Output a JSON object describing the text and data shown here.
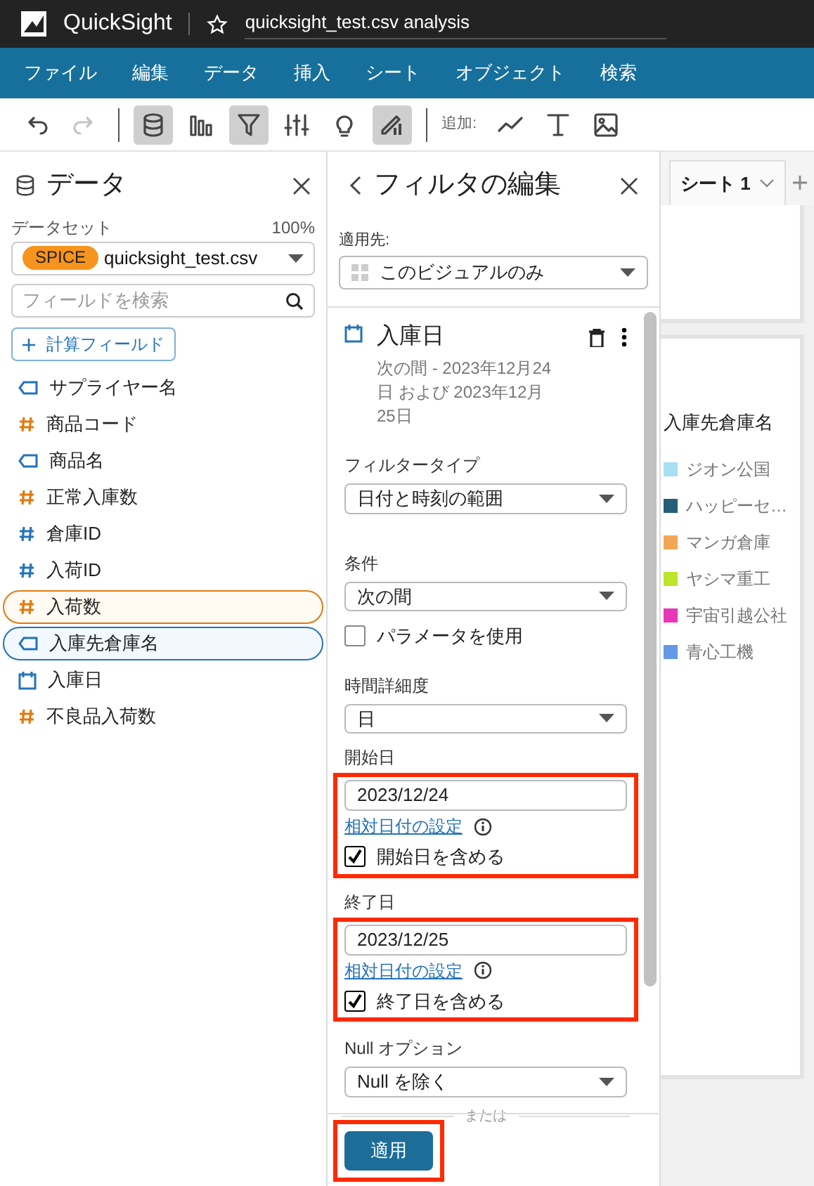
{
  "app": {
    "name": "QuickSight",
    "document_title": "quicksight_test.csv analysis"
  },
  "menu": [
    "ファイル",
    "編集",
    "データ",
    "挿入",
    "シート",
    "オブジェクト",
    "検索"
  ],
  "toolbar": {
    "groups": [
      [
        {
          "kind": "undo",
          "disabled": false,
          "active": false
        },
        {
          "kind": "redo",
          "disabled": true,
          "active": false
        }
      ],
      [
        {
          "kind": "data",
          "disabled": false,
          "active": true
        },
        {
          "kind": "visualize",
          "disabled": false,
          "active": false
        },
        {
          "kind": "filter",
          "disabled": false,
          "active": true
        },
        {
          "kind": "parameters",
          "disabled": false,
          "active": false
        },
        {
          "kind": "insights",
          "disabled": false,
          "active": false
        },
        {
          "kind": "format",
          "disabled": false,
          "active": true
        }
      ]
    ],
    "add_label": "追加:",
    "add_tools": [
      {
        "kind": "line"
      },
      {
        "kind": "text"
      },
      {
        "kind": "image"
      }
    ]
  },
  "data_panel": {
    "title": "データ",
    "dataset_label": "データセット",
    "dataset_percent": "100%",
    "spice_badge": "SPICE",
    "dataset": "quicksight_test.csv",
    "search": {
      "placeholder": "フィールドを検索"
    },
    "add_calc_field": "計算フィールド",
    "fields": [
      {
        "name": "サプライヤー名",
        "kind": "dimension",
        "selected": false
      },
      {
        "name": "商品コード",
        "kind": "measure",
        "selected": false
      },
      {
        "name": "商品名",
        "kind": "dimension",
        "selected": false
      },
      {
        "name": "正常入庫数",
        "kind": "measure",
        "selected": false
      },
      {
        "name": "倉庫ID",
        "kind": "id",
        "selected": false
      },
      {
        "name": "入荷ID",
        "kind": "id",
        "selected": false
      },
      {
        "name": "入荷数",
        "kind": "measure",
        "selected": true
      },
      {
        "name": "入庫先倉庫名",
        "kind": "dimension",
        "selected": true
      },
      {
        "name": "入庫日",
        "kind": "date",
        "selected": false
      },
      {
        "name": "不良品入荷数",
        "kind": "measure",
        "selected": false
      }
    ]
  },
  "filter_panel": {
    "title": "フィルタの編集",
    "apply_to_label": "適用先:",
    "apply_to": "このビジュアルのみ",
    "field": "入庫日",
    "summary": "次の間 - 2023年12月24日 および 2023年12月25日",
    "filter_type_label": "フィルタータイプ",
    "filter_type": "日付と時刻の範囲",
    "condition_label": "条件",
    "condition": "次の間",
    "use_parameter": {
      "label": "パラメータを使用",
      "checked": false
    },
    "granularity_label": "時間詳細度",
    "granularity": "日",
    "dates": [
      {
        "label": "開始日",
        "value": "2023/12/24",
        "relative_link": "相対日付の設定",
        "include": {
          "label": "開始日を含める",
          "checked": true
        },
        "highlighted": true
      },
      {
        "label": "終了日",
        "value": "2023/12/25",
        "relative_link": "相対日付の設定",
        "include": {
          "label": "終了日を含める",
          "checked": true
        },
        "highlighted": true
      }
    ],
    "null_label": "Null オプション",
    "null_option": "Null を除く",
    "or_label": "または",
    "apply_button": {
      "label": "適用",
      "highlighted": true
    }
  },
  "canvas": {
    "sheet_tab": {
      "label": "シート 1",
      "selected": true
    },
    "legend": {
      "title": "入庫先倉庫名",
      "items": [
        {
          "label": "ジオン公国",
          "color": "#a6e1f2"
        },
        {
          "label": "ハッピーセ…",
          "color": "#245e79"
        },
        {
          "label": "マンガ倉庫",
          "color": "#f5a655"
        },
        {
          "label": "ヤシマ重工",
          "color": "#bde52d"
        },
        {
          "label": "宇宙引越公社",
          "color": "#e637b8"
        },
        {
          "label": "青心工機",
          "color": "#6499e5"
        }
      ]
    }
  }
}
